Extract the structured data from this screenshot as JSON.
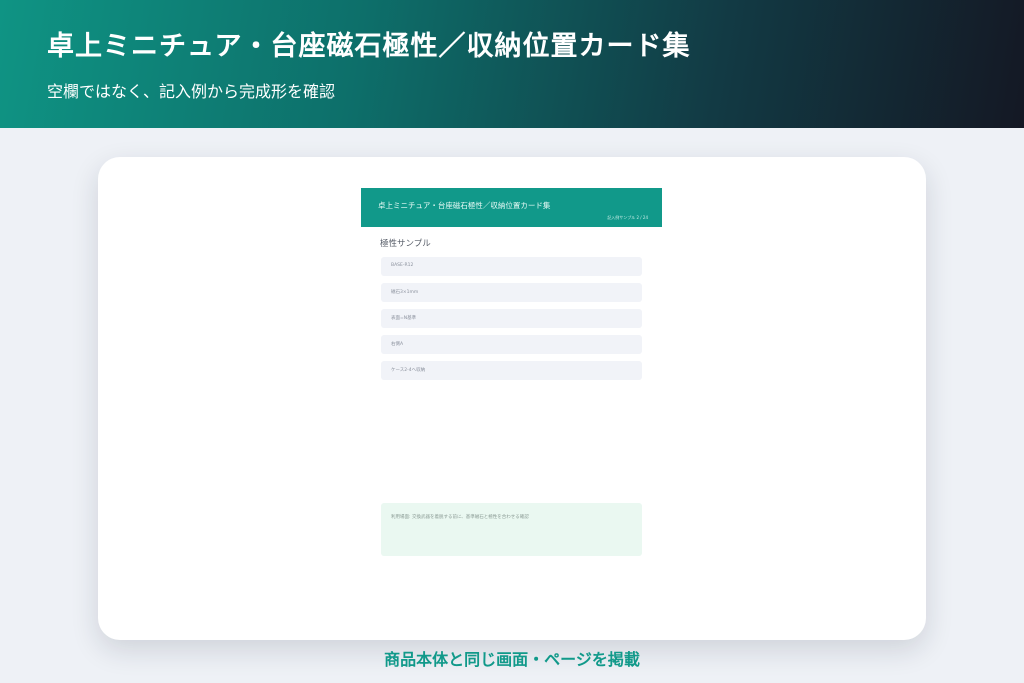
{
  "header": {
    "title": "卓上ミニチュア・台座磁石極性／収納位置カード集",
    "subtitle": "空欄ではなく、記入例から完成形を確認"
  },
  "sample_card": {
    "title": "卓上ミニチュア・台座磁石極性／収納位置カード集",
    "subtitle": "記入例サンプル 2 / 24",
    "section_label": "極性サンプル",
    "fields": [
      "BASE-R12",
      "磁石3×1mm",
      "表面=N基準",
      "右側A",
      "ケース2-4へ収納"
    ],
    "note": "利用場面: 交換武器を着脱する前に、基準磁石と極性を合わせる確認"
  },
  "caption": "商品本体と同じ画面・ページを掲載",
  "colors": {
    "accent": "#11998a",
    "header_dark": "#141824",
    "field_bg": "#f1f3f8",
    "note_bg": "#eaf8f1"
  }
}
